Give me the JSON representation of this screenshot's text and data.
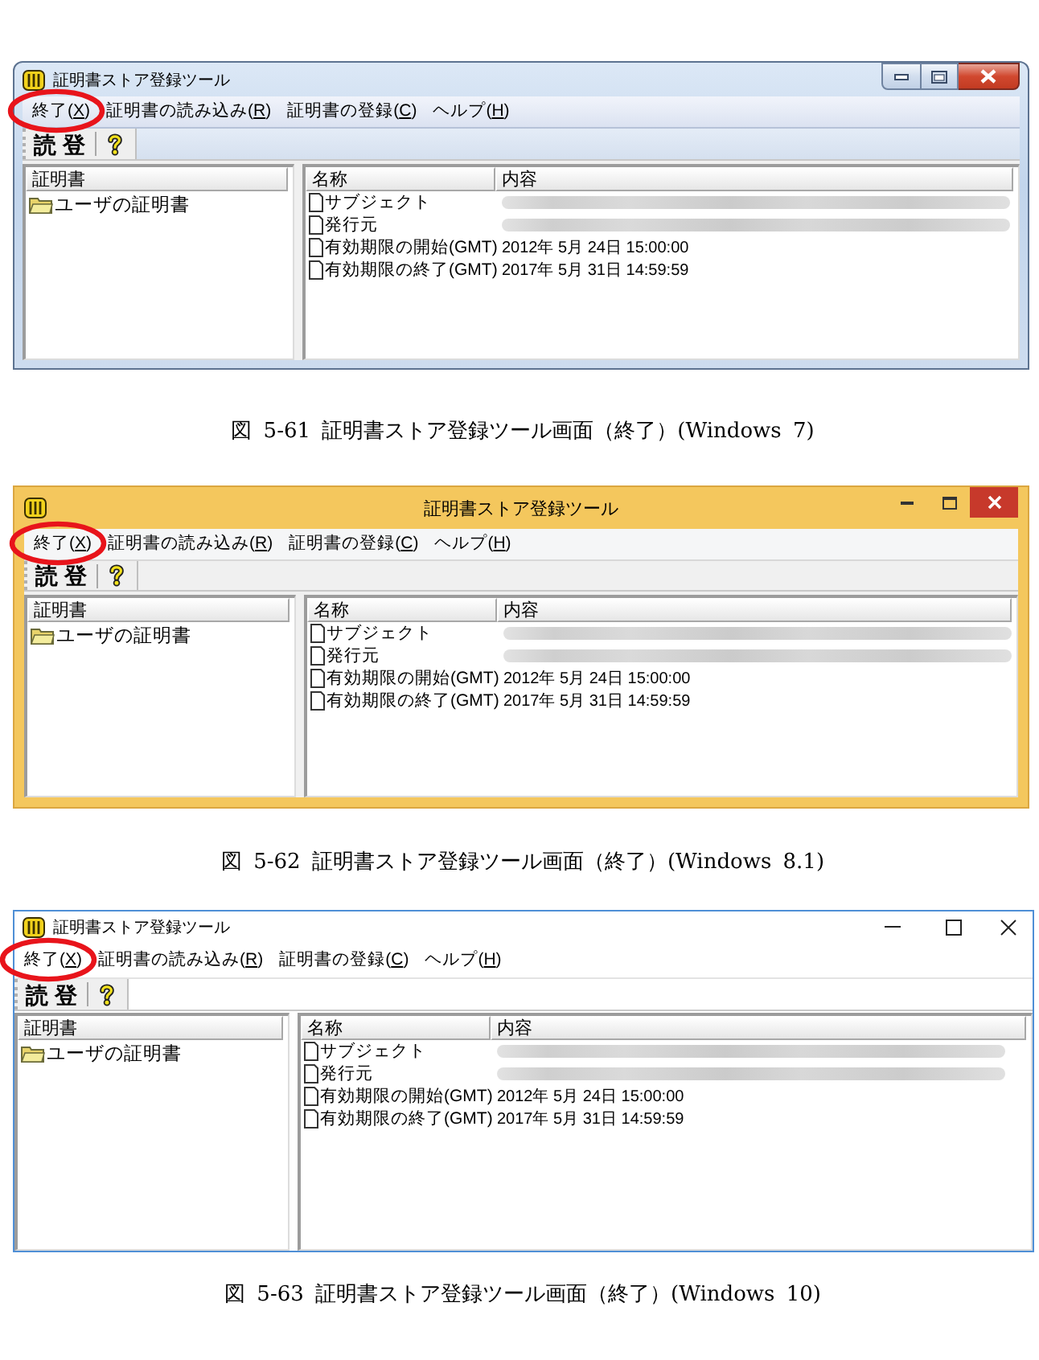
{
  "figures": [
    {
      "kind": "win7",
      "window": {
        "title": "証明書ストア登録ツール"
      },
      "menu": [
        {
          "before": "終了(",
          "key": "X",
          "after": ")",
          "circled": true
        },
        {
          "before": "証明書の読み込み(",
          "key": "R",
          "after": ")",
          "circled": false
        },
        {
          "before": "証明書の登録(",
          "key": "C",
          "after": ")",
          "circled": false
        },
        {
          "before": "ヘルプ(",
          "key": "H",
          "after": ")",
          "circled": false
        }
      ],
      "toolbar": [
        {
          "kind": "glyph",
          "label": "読"
        },
        {
          "kind": "glyph",
          "label": "登"
        },
        {
          "kind": "help"
        }
      ],
      "tree": {
        "header": "証明書",
        "items": [
          {
            "label": "ユーザの証明書"
          }
        ]
      },
      "list": {
        "columns": [
          "名称",
          "内容"
        ],
        "rows": [
          {
            "kind": "redacted",
            "name": "サブジェクト"
          },
          {
            "kind": "redacted",
            "name": "発行元"
          },
          {
            "kind": "text",
            "name": "有効期限の開始(GMT)",
            "value": "2012年 5月 24日 15:00:00"
          },
          {
            "kind": "text",
            "name": "有効期限の終了(GMT)",
            "value": "2017年 5月 31日 14:59:59"
          }
        ]
      },
      "caption": "図 5-61 証明書ストア登録ツール画面（終了）(Windows 7)"
    },
    {
      "kind": "win8",
      "window": {
        "title": "証明書ストア登録ツール"
      },
      "menu": [
        {
          "before": "終了(",
          "key": "X",
          "after": ")",
          "circled": true
        },
        {
          "before": "証明書の読み込み(",
          "key": "R",
          "after": ")",
          "circled": false
        },
        {
          "before": "証明書の登録(",
          "key": "C",
          "after": ")",
          "circled": false
        },
        {
          "before": "ヘルプ(",
          "key": "H",
          "after": ")",
          "circled": false
        }
      ],
      "toolbar": [
        {
          "kind": "glyph",
          "label": "読"
        },
        {
          "kind": "glyph",
          "label": "登"
        },
        {
          "kind": "help"
        }
      ],
      "tree": {
        "header": "証明書",
        "items": [
          {
            "label": "ユーザの証明書"
          }
        ]
      },
      "list": {
        "columns": [
          "名称",
          "内容"
        ],
        "rows": [
          {
            "kind": "redacted",
            "name": "サブジェクト"
          },
          {
            "kind": "redacted",
            "name": "発行元"
          },
          {
            "kind": "text",
            "name": "有効期限の開始(GMT)",
            "value": "2012年 5月 24日 15:00:00"
          },
          {
            "kind": "text",
            "name": "有効期限の終了(GMT)",
            "value": "2017年 5月 31日 14:59:59"
          }
        ]
      },
      "caption": "図 5-62 証明書ストア登録ツール画面（終了）(Windows 8.1)"
    },
    {
      "kind": "win10",
      "window": {
        "title": "証明書ストア登録ツール"
      },
      "menu": [
        {
          "before": "終了(",
          "key": "X",
          "after": ")",
          "circled": true
        },
        {
          "before": "証明書の読み込み(",
          "key": "R",
          "after": ")",
          "circled": false
        },
        {
          "before": "証明書の登録(",
          "key": "C",
          "after": ")",
          "circled": false
        },
        {
          "before": "ヘルプ(",
          "key": "H",
          "after": ")",
          "circled": false
        }
      ],
      "toolbar": [
        {
          "kind": "glyph",
          "label": "読"
        },
        {
          "kind": "glyph",
          "label": "登"
        },
        {
          "kind": "help"
        }
      ],
      "tree": {
        "header": "証明書",
        "items": [
          {
            "label": "ユーザの証明書"
          }
        ]
      },
      "list": {
        "columns": [
          "名称",
          "内容"
        ],
        "rows": [
          {
            "kind": "redacted",
            "name": "サブジェクト"
          },
          {
            "kind": "redacted",
            "name": "発行元"
          },
          {
            "kind": "text",
            "name": "有効期限の開始(GMT)",
            "value": "2012年 5月 24日 15:00:00"
          },
          {
            "kind": "text",
            "name": "有効期限の終了(GMT)",
            "value": "2017年 5月 31日 14:59:59"
          }
        ]
      },
      "caption": "図 5-63 証明書ストア登録ツール画面（終了）(Windows 10)"
    }
  ]
}
